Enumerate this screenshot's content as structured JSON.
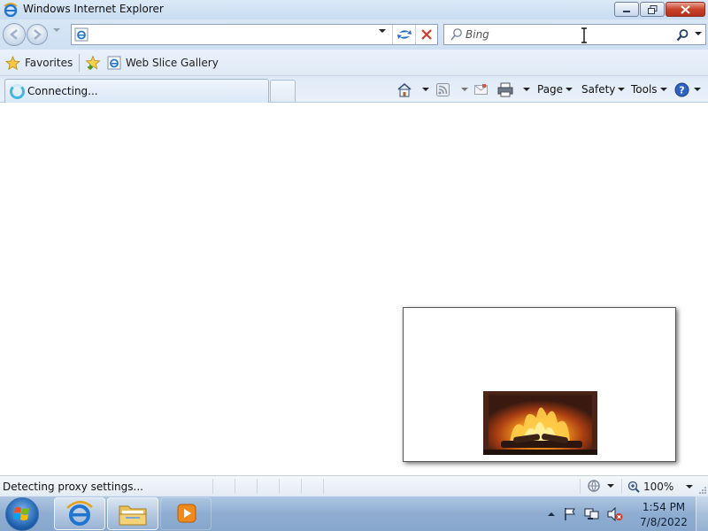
{
  "window": {
    "title": "Windows Internet Explorer",
    "icon": "ie-icon",
    "controls": [
      "minimize-icon",
      "restore-icon",
      "close-icon"
    ]
  },
  "navigation": {
    "address_value": "",
    "address_placeholder": "",
    "search_placeholder": "Bing",
    "search_value": ""
  },
  "favorites_bar": {
    "favorites_label": "Favorites",
    "items": [
      {
        "label": "Web Slice Gallery",
        "icon": "ie-page-icon"
      }
    ]
  },
  "tabs": [
    {
      "label": "Connecting...",
      "state": "loading"
    }
  ],
  "command_bar": {
    "page_label": "Page",
    "safety_label": "Safety",
    "tools_label": "Tools"
  },
  "content": {
    "popup": {
      "image": "fireplace-image"
    }
  },
  "status_bar": {
    "status_text": "Detecting proxy settings...",
    "zoom": "100%"
  },
  "taskbar": {
    "pinned": [
      "internet-explorer",
      "windows-explorer",
      "windows-media-player"
    ],
    "clock_time": "1:54 PM",
    "clock_date": "7/8/2022"
  },
  "colors": {
    "title_gradient_top": "#dce9f7",
    "close_button": "#c9432a",
    "taskbar": "#8fadd1",
    "loading_spinner": "#42b6df"
  }
}
